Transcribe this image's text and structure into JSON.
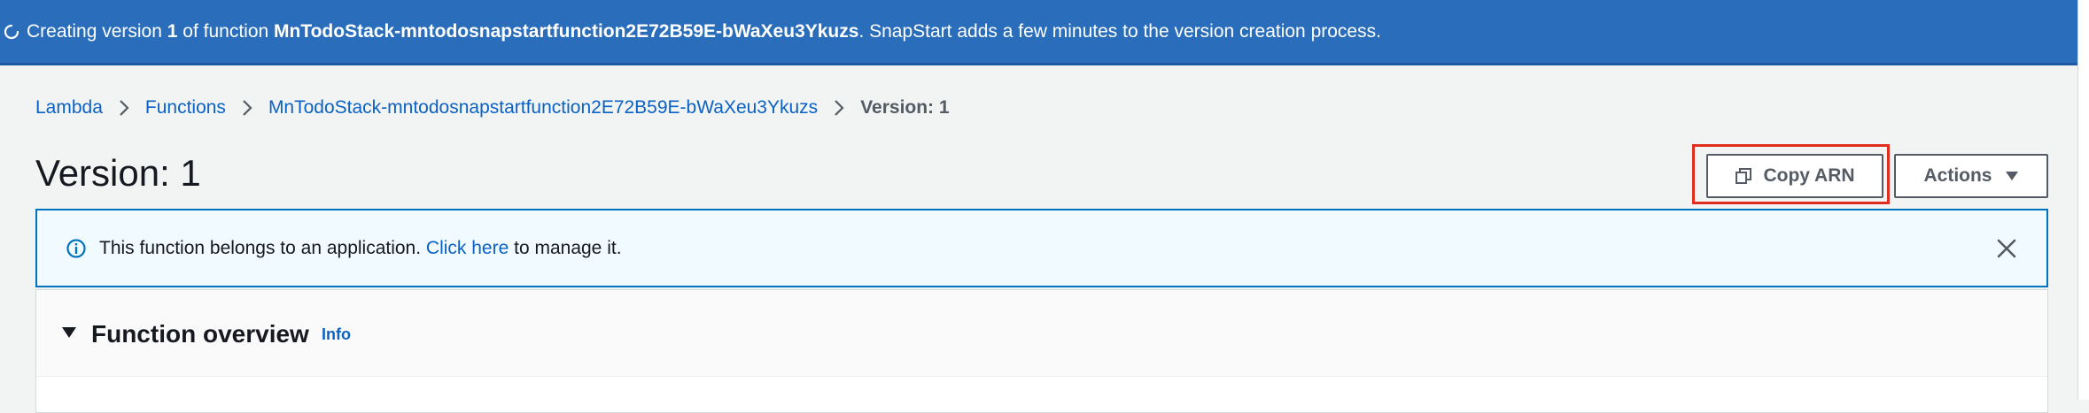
{
  "flash": {
    "prefix": "Creating version ",
    "version": "1",
    "middle": " of function ",
    "function_name": "MnTodoStack-mntodosnapstartfunction2E72B59E-bWaXeu3Ykuzs",
    "suffix": ". SnapStart adds a few minutes to the version creation process."
  },
  "breadcrumb": {
    "items": [
      "Lambda",
      "Functions",
      "MnTodoStack-mntodosnapstartfunction2E72B59E-bWaXeu3Ykuzs"
    ],
    "current": "Version: 1"
  },
  "page": {
    "title": "Version: 1"
  },
  "header_buttons": {
    "copy_arn": "Copy ARN",
    "actions": "Actions"
  },
  "info_alert": {
    "text_before": "This function belongs to an application. ",
    "link": "Click here",
    "text_after": " to manage it."
  },
  "panel": {
    "title": "Function overview",
    "info_link": "Info"
  },
  "colors": {
    "flash_bg": "#2a6ebb",
    "link": "#0b62c4",
    "highlight": "#e02d20",
    "info_border": "#0073bb"
  },
  "icons": [
    "spinner-icon",
    "chevron-right-icon",
    "copy-icon",
    "caret-down-icon",
    "info-icon",
    "close-icon",
    "caret-down-filled-icon"
  ]
}
